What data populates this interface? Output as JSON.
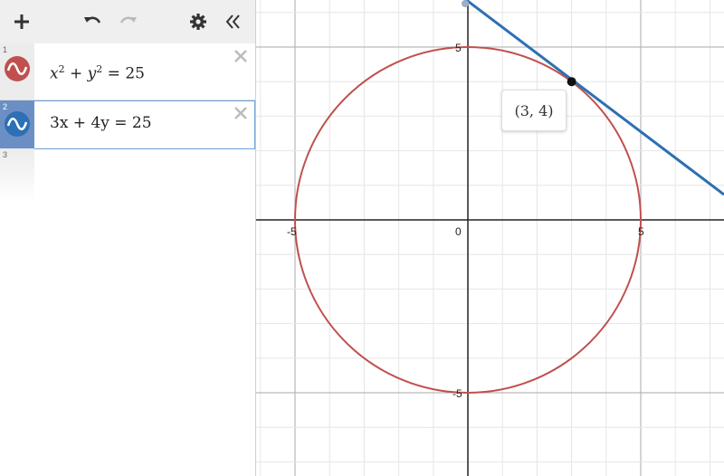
{
  "toolbar": {
    "add_icon": "plus-icon",
    "undo_icon": "undo-icon",
    "redo_icon": "redo-icon",
    "settings_icon": "gear-icon",
    "collapse_icon": "double-chevron-left-icon"
  },
  "expressions": [
    {
      "number": "1",
      "latex_base1": "x",
      "latex_sup1": "2",
      "latex_mid": " + ",
      "latex_base2": "y",
      "latex_sup2": "2",
      "latex_rest": " = 25",
      "color": "#c0504d"
    },
    {
      "number": "2",
      "latex": "3x + 4y = 25",
      "color": "#2d70b3"
    }
  ],
  "empty_expression": {
    "number": "3"
  },
  "graph": {
    "axis_labels": {
      "x_neg": "-5",
      "origin": "0",
      "x_pos": "5",
      "y_pos": "5",
      "y_neg": "-5"
    },
    "point_label": "(3, 4)",
    "circle_color": "#c0504d",
    "line_color": "#2d70b3"
  }
}
